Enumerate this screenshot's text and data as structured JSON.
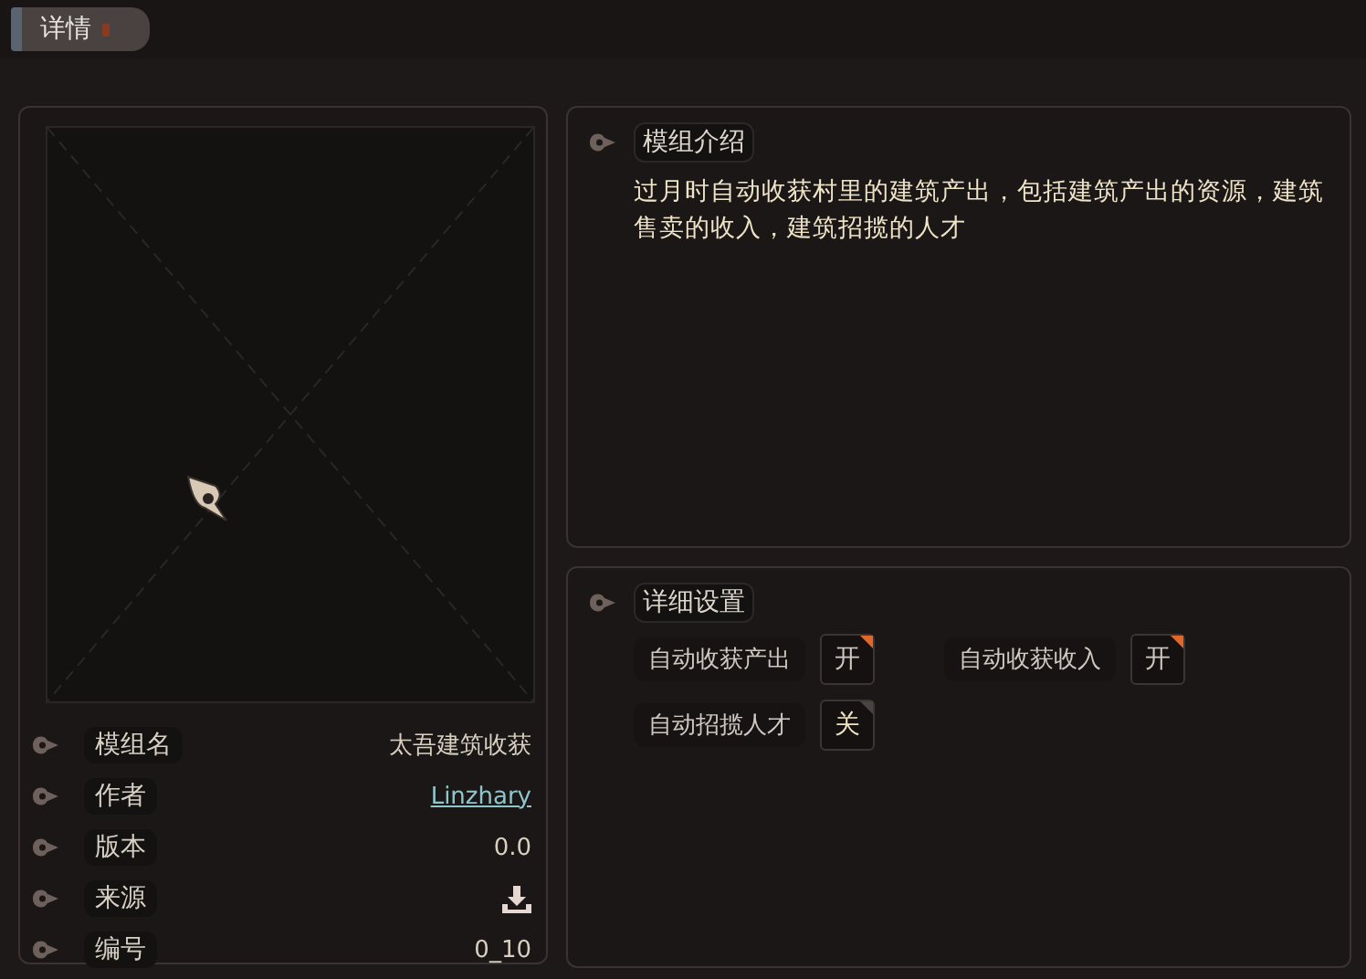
{
  "title_tab": {
    "label": "详情"
  },
  "info": [
    {
      "label": "模组名",
      "value": "太吾建筑收获",
      "kind": "text"
    },
    {
      "label": "作者",
      "value": "Linzhary",
      "kind": "link"
    },
    {
      "label": "版本",
      "value": "0.0",
      "kind": "text"
    },
    {
      "label": "来源",
      "kind": "download"
    },
    {
      "label": "编号",
      "value": "0_10",
      "kind": "text"
    }
  ],
  "description": {
    "heading": "模组介绍",
    "text": "过月时自动收获村里的建筑产出，包括建筑产出的资源，建筑售卖的收入，建筑招揽的人才"
  },
  "settings": {
    "heading": "详细设置",
    "items": [
      {
        "label": "自动收获产出",
        "value": "开",
        "on": true
      },
      {
        "label": "自动收获收入",
        "value": "开",
        "on": true
      },
      {
        "label": "自动招揽人才",
        "value": "关",
        "on": false
      }
    ]
  }
}
